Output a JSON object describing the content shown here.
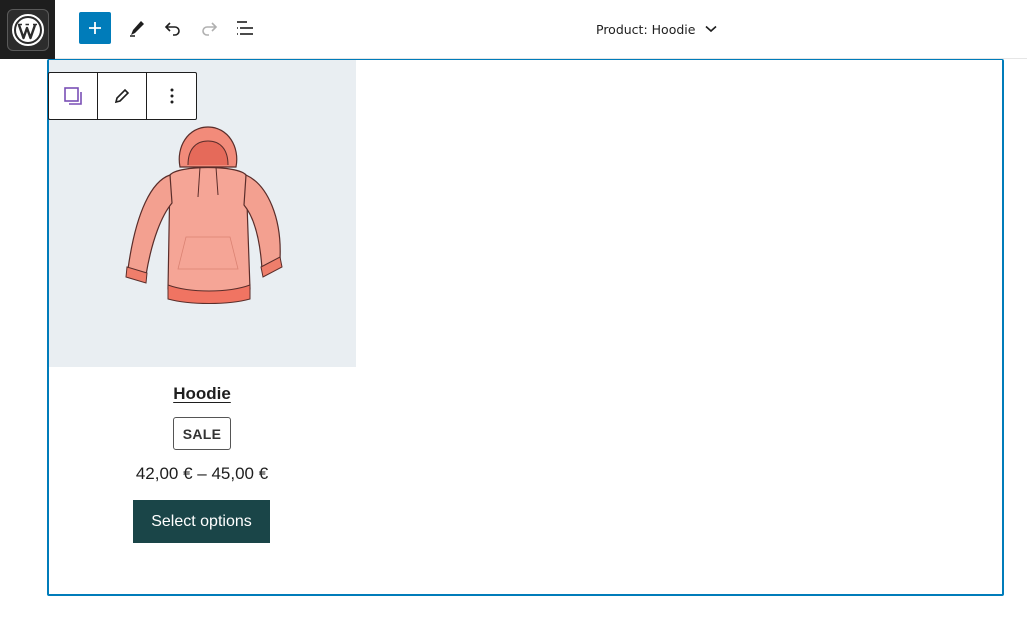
{
  "header": {
    "document_title": "Product: Hoodie"
  },
  "product": {
    "title": "Hoodie",
    "badge": "SALE",
    "price": "42,00 € – 45,00 €",
    "button_label": "Select options"
  },
  "colors": {
    "accent": "#007cba",
    "button_bg": "#1a4548",
    "image_bg": "#e9eef2"
  }
}
